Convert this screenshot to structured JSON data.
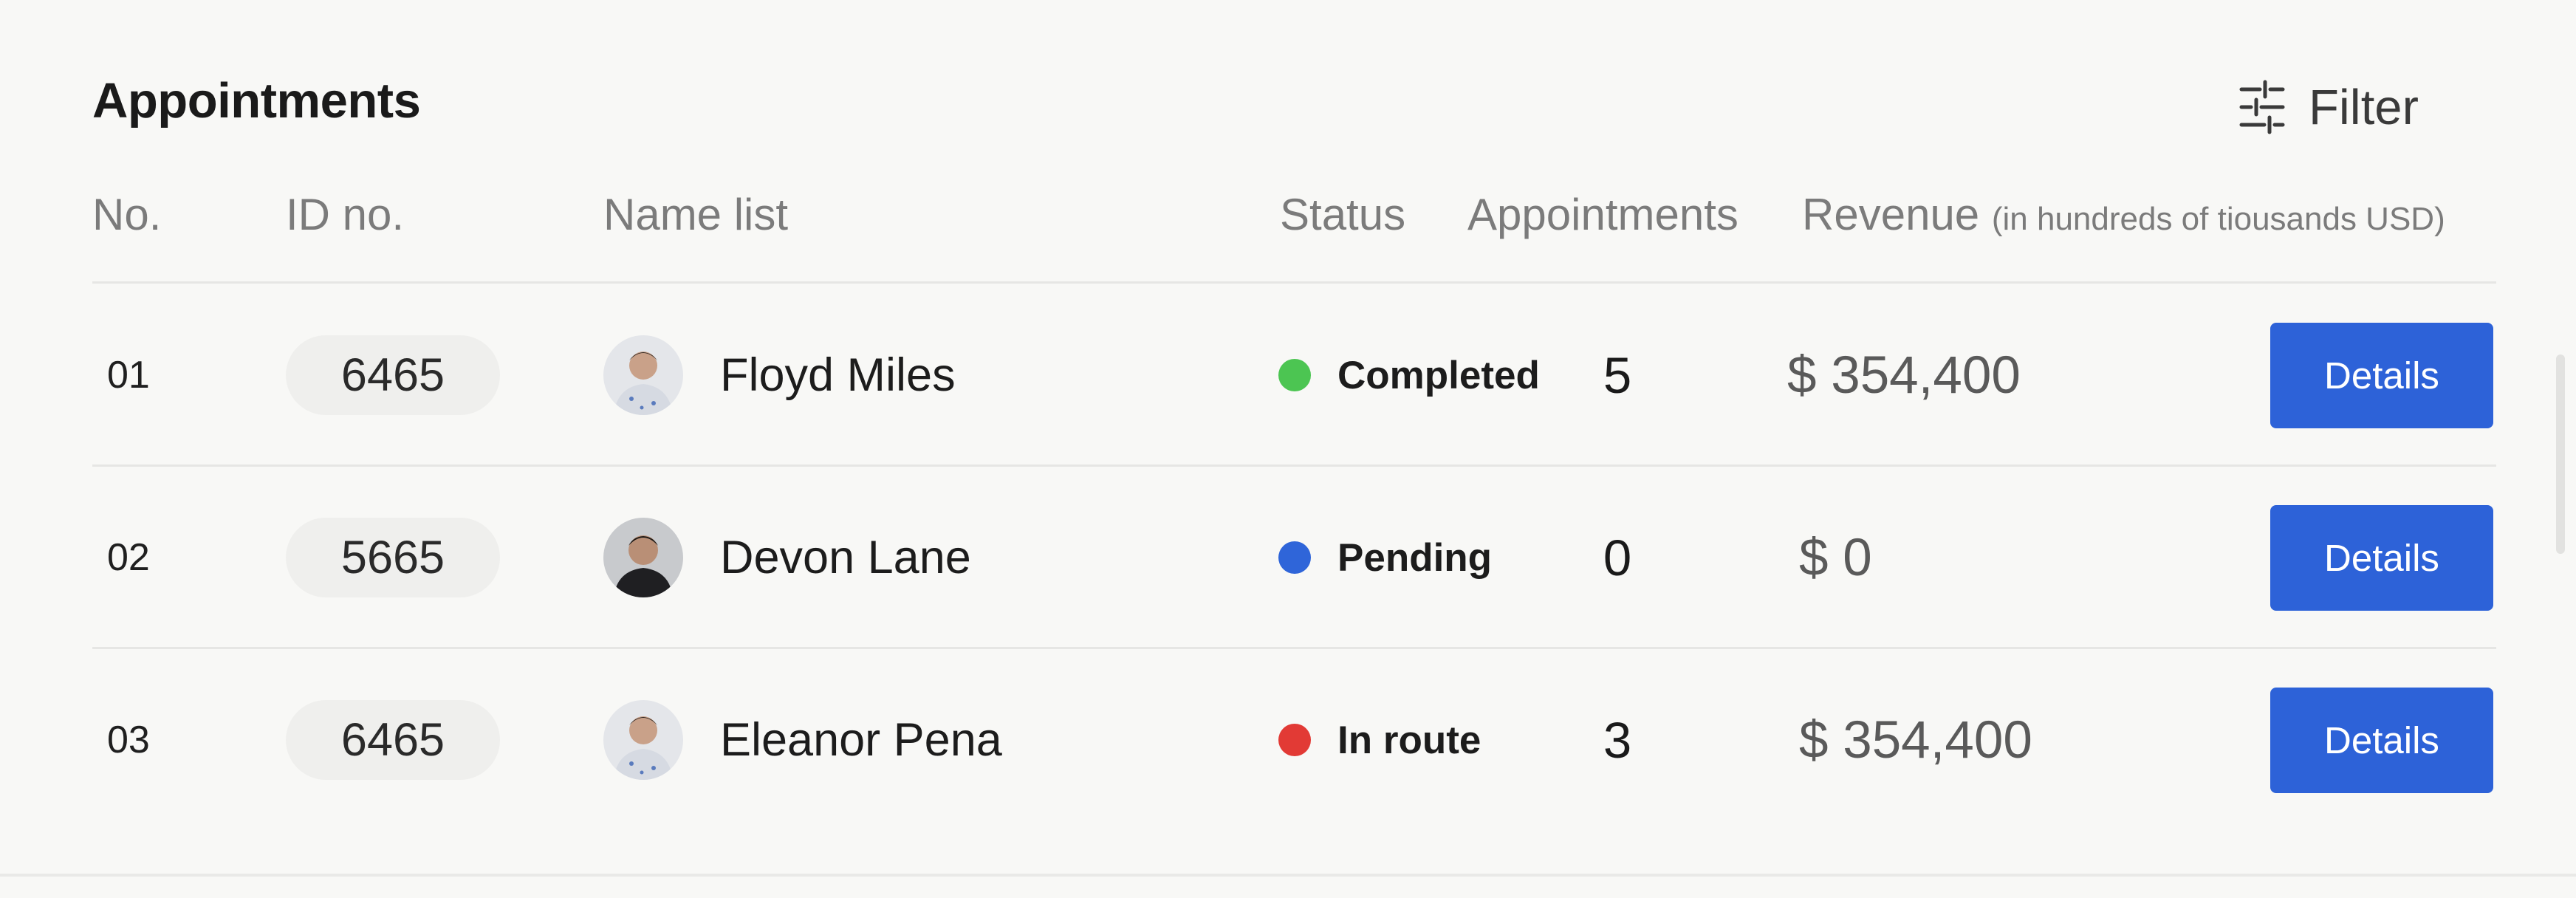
{
  "header": {
    "title": "Appointments",
    "filter_label": "Filter"
  },
  "columns": {
    "no": "No.",
    "id": "ID no.",
    "name": "Name list",
    "status": "Status",
    "appointments": "Appointments",
    "revenue": "Revenue",
    "revenue_note": "(in hundreds of tiousands USD)"
  },
  "rows": [
    {
      "no": "01",
      "id": "6465",
      "name": "Floyd Miles",
      "status": "Completed",
      "status_color": "#4cc552",
      "appointments": "5",
      "revenue": "$ 354,400",
      "action": "Details"
    },
    {
      "no": "02",
      "id": "5665",
      "name": "Devon Lane",
      "status": "Pending",
      "status_color": "#2f65d9",
      "appointments": "0",
      "revenue": "$ 0",
      "action": "Details"
    },
    {
      "no": "03",
      "id": "6465",
      "name": "Eleanor Pena",
      "status": "In route",
      "status_color": "#e23a35",
      "appointments": "3",
      "revenue": "$ 354,400",
      "action": "Details"
    }
  ],
  "colors": {
    "accent": "#2d62d8",
    "background": "#f8f8f6"
  },
  "icons": {
    "filter": "sliders-icon",
    "avatar": "user-avatar"
  }
}
